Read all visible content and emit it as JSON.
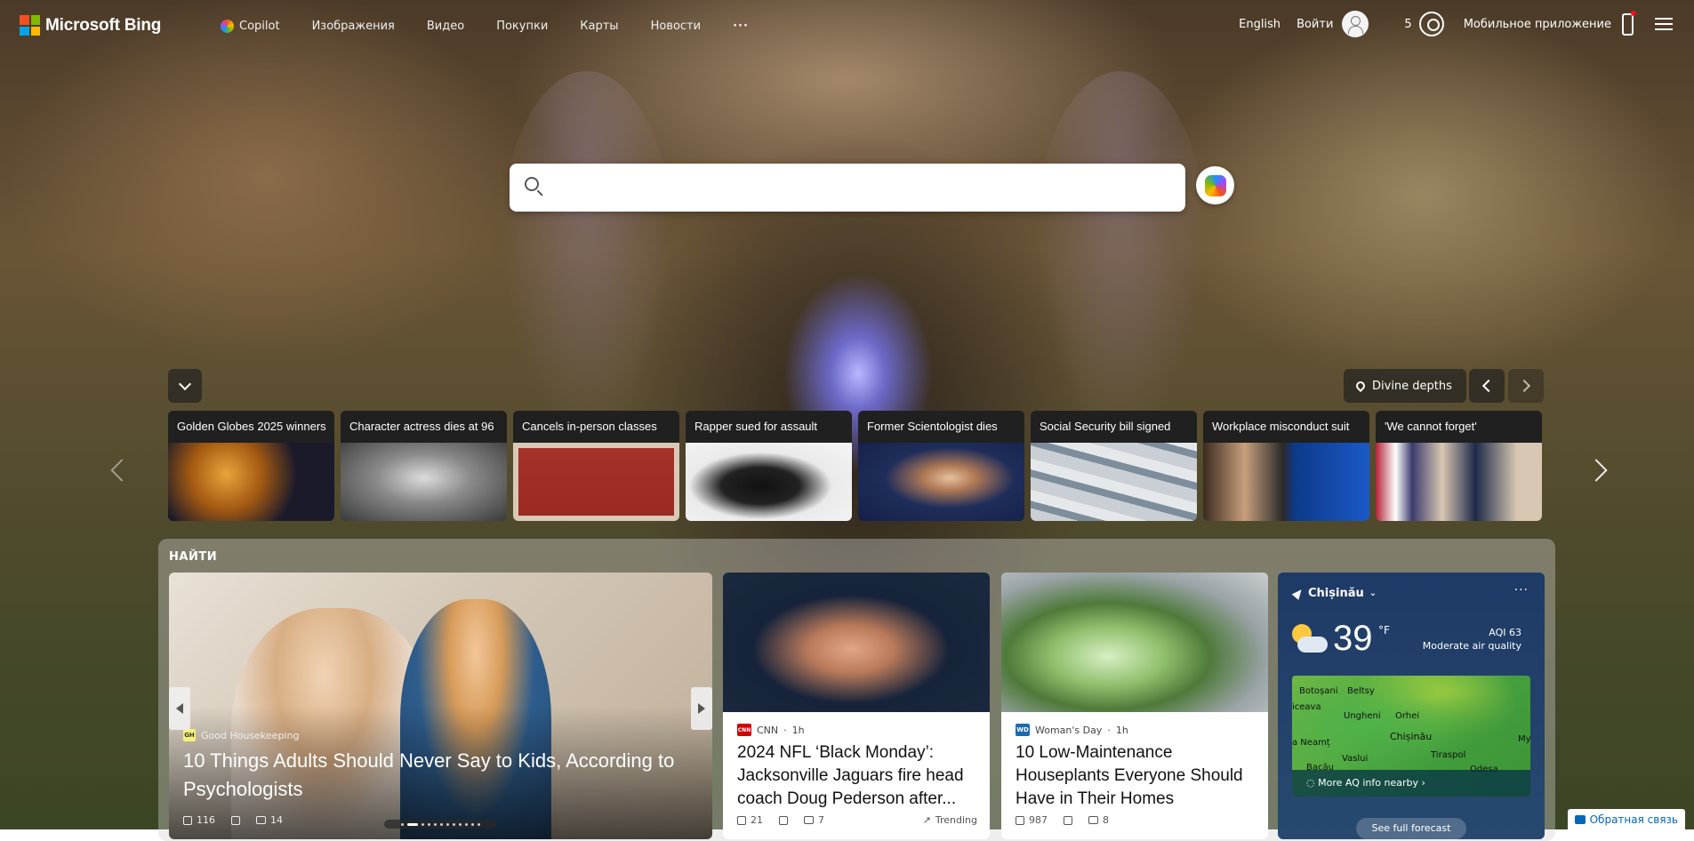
{
  "brand": {
    "name": "Microsoft Bing",
    "colors": [
      "#f25022",
      "#7fba00",
      "#00a4ef",
      "#ffb900"
    ]
  },
  "nav": {
    "links": [
      "Copilot",
      "Изображения",
      "Видео",
      "Покупки",
      "Карты",
      "Новости"
    ],
    "more": "···",
    "language": "English",
    "sign_in": "Войти",
    "rewards_count": "5",
    "mobile_app": "Мобильное приложение"
  },
  "search": {
    "placeholder": "",
    "value": ""
  },
  "carousel": {
    "location_label": "Divine depths",
    "tiles": [
      {
        "caption": "Golden Globes 2025 winners"
      },
      {
        "caption": "Character actress dies at 96"
      },
      {
        "caption": "Cancels in-person classes"
      },
      {
        "caption": "Rapper sued for assault"
      },
      {
        "caption": "Former Scientologist dies"
      },
      {
        "caption": "Social Security bill signed"
      },
      {
        "caption": "Workplace misconduct suit"
      },
      {
        "caption": "'We cannot forget'"
      }
    ]
  },
  "feed": {
    "section_title": "НАЙТИ",
    "hero": {
      "source": "Good Housekeeping",
      "source_badge": "GH",
      "title": "10 Things Adults Should Never Say to Kids, According to Psychologists",
      "likes": "116",
      "comments": "14"
    },
    "cards": [
      {
        "source": "CNN",
        "source_badge": "CNN",
        "time": "1h",
        "title": "2024 NFL ‘Black Monday’: Jacksonville Jaguars fire head coach Doug Pederson after...",
        "likes": "21",
        "comments": "7",
        "tag": "Trending"
      },
      {
        "source": "Woman's Day",
        "source_badge": "WD",
        "time": "1h",
        "title": "10 Low-Maintenance Houseplants Everyone Should Have in Their Homes",
        "likes": "987",
        "comments": "8"
      }
    ]
  },
  "weather": {
    "location": "Chișinău",
    "more": "···",
    "temperature": "39",
    "unit": "°F",
    "aqi": "AQI 63",
    "aqi_text": "Moderate air quality",
    "map_labels": [
      "Botoșani",
      "Beltsy",
      "iceava",
      "Ungheni",
      "Orhei",
      "Chișinău",
      "a Neamț",
      "Vaslui",
      "Tiraspol",
      "Bacău",
      "Odesa",
      "My"
    ],
    "more_aq": "More AQ info nearby",
    "forecast": "See full forecast"
  },
  "feedback": "Обратная связь"
}
